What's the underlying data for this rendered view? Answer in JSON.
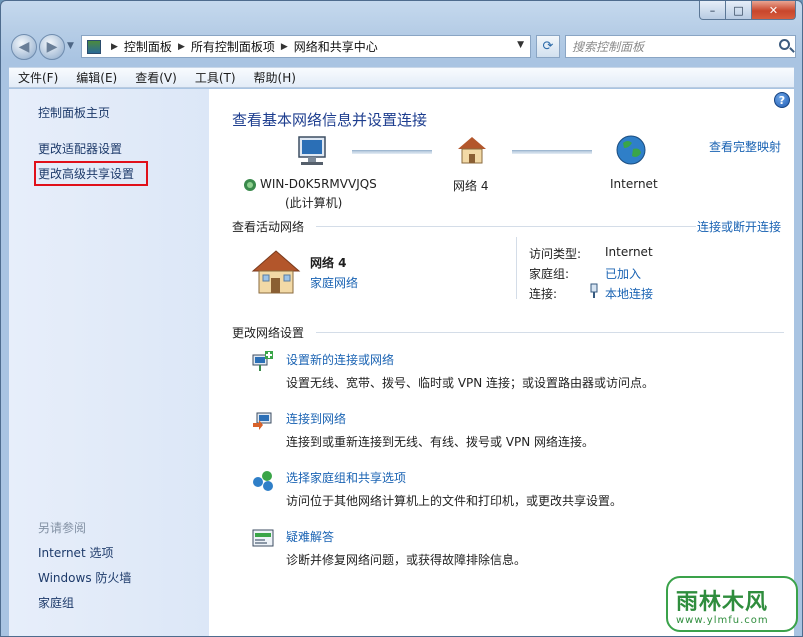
{
  "window": {
    "caption_buttons": {
      "minimize": "–",
      "maximize": "□",
      "close": "✕"
    }
  },
  "address_bar": {
    "crumbs": [
      "控制面板",
      "所有控制面板项",
      "网络和共享中心"
    ],
    "search_placeholder": "搜索控制面板"
  },
  "menu": [
    "文件(F)",
    "编辑(E)",
    "查看(V)",
    "工具(T)",
    "帮助(H)"
  ],
  "sidebar": {
    "links": [
      "控制面板主页",
      "更改适配器设置",
      "更改高级共享设置"
    ],
    "highlighted_index": 2,
    "see_also_label": "另请参阅",
    "see_also": [
      "Internet 选项",
      "Windows 防火墙",
      "家庭组"
    ]
  },
  "main": {
    "title": "查看基本网络信息并设置连接",
    "full_map_link": "查看完整映射",
    "map": {
      "computer_name": "WIN-D0K5RMVVJQS",
      "computer_sub": "(此计算机)",
      "network": "网络  4",
      "internet": "Internet"
    },
    "active_networks": {
      "heading": "查看活动网络",
      "connect_link": "连接或断开连接",
      "network_name": "网络  4",
      "network_type": "家庭网络",
      "access_type_key": "访问类型:",
      "access_type_val": "Internet",
      "homegroup_key": "家庭组:",
      "homegroup_val": "已加入",
      "connection_key": "连接:",
      "connection_val": "本地连接"
    },
    "change_settings": {
      "heading": "更改网络设置",
      "tasks": [
        {
          "title": "设置新的连接或网络",
          "desc": "设置无线、宽带、拨号、临时或 VPN 连接；或设置路由器或访问点。",
          "icon": "new-connection-icon"
        },
        {
          "title": "连接到网络",
          "desc": "连接到或重新连接到无线、有线、拨号或 VPN 网络连接。",
          "icon": "connect-network-icon"
        },
        {
          "title": "选择家庭组和共享选项",
          "desc": "访问位于其他网络计算机上的文件和打印机，或更改共享设置。",
          "icon": "homegroup-icon"
        },
        {
          "title": "疑难解答",
          "desc": "诊断并修复网络问题，或获得故障排除信息。",
          "icon": "troubleshoot-icon"
        }
      ]
    }
  },
  "watermark": {
    "title": "雨林木风",
    "url": "www.ylmfu.com"
  },
  "help_label": "?"
}
